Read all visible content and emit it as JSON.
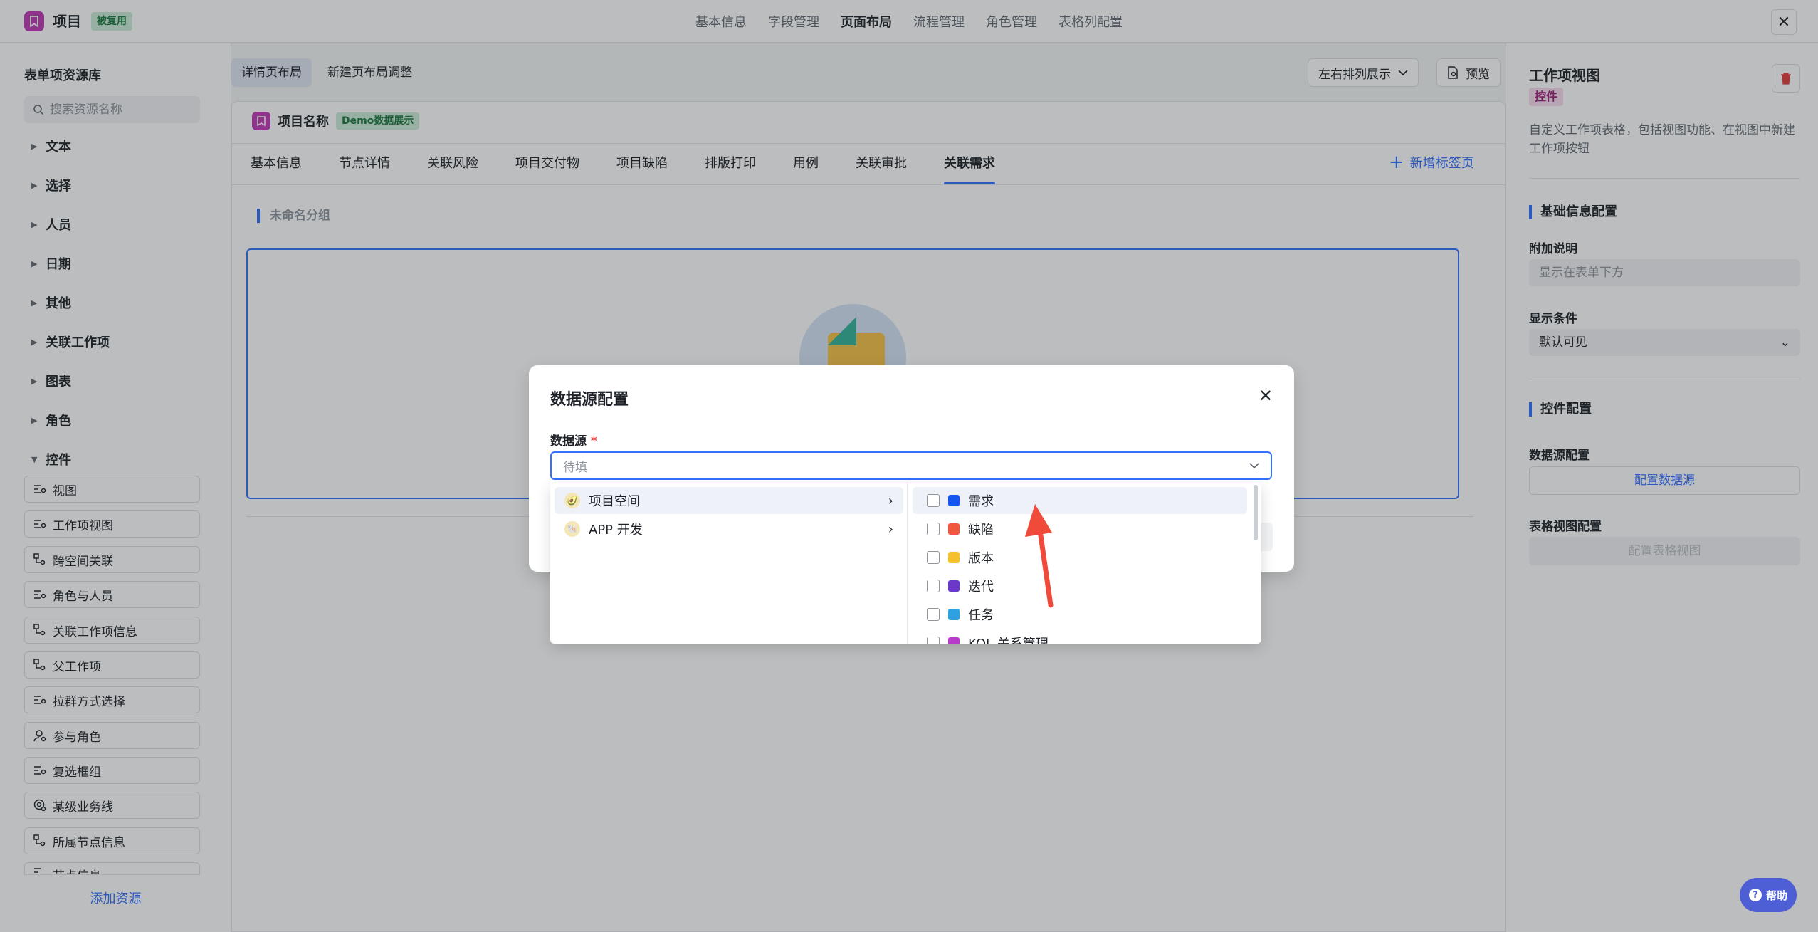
{
  "header": {
    "app_title": "项目",
    "app_badge": "被复用",
    "nav": [
      "基本信息",
      "字段管理",
      "页面布局",
      "流程管理",
      "角色管理",
      "表格列配置"
    ],
    "active_nav": "页面布局"
  },
  "sidebar": {
    "title": "表单项资源库",
    "search_placeholder": "搜索资源名称",
    "categories": [
      "文本",
      "选择",
      "人员",
      "日期",
      "其他",
      "关联工作项",
      "图表",
      "角色"
    ],
    "expanded_category": "控件",
    "widgets": [
      "视图",
      "工作项视图",
      "跨空间关联",
      "角色与人员",
      "关联工作项信息",
      "父工作项",
      "拉群方式选择",
      "参与角色",
      "复选框组",
      "某级业务线",
      "所属节点信息",
      "节点信息"
    ],
    "add_resource": "添加资源"
  },
  "center": {
    "segments": [
      "详情页布局",
      "新建页布局调整"
    ],
    "sort_button": "左右排列展示",
    "preview_button": "预览",
    "card_title": "项目名称",
    "card_badge": "Demo数据展示",
    "tabs": [
      "基本信息",
      "节点详情",
      "关联风险",
      "项目交付物",
      "项目缺陷",
      "排版打印",
      "用例",
      "关联审批",
      "关联需求"
    ],
    "active_tab": "关联需求",
    "add_tab": "新增标签页",
    "group_label": "未命名分组"
  },
  "right_panel": {
    "title": "工作项视图",
    "badge": "控件",
    "description": "自定义工作项表格，包括视图功能、在视图中新建工作项按钮",
    "basic_section": "基础信息配置",
    "extra_label": "附加说明",
    "extra_placeholder": "显示在表单下方",
    "display_label": "显示条件",
    "display_value": "默认可见",
    "control_section": "控件配置",
    "datasource_label": "数据源配置",
    "datasource_button": "配置数据源",
    "tableview_label": "表格视图配置",
    "tableview_button": "配置表格视图"
  },
  "help": {
    "label": "帮助"
  },
  "modal": {
    "title": "数据源配置",
    "field_label": "数据源",
    "required_mark": "*",
    "select_placeholder": "待填"
  },
  "dropdown": {
    "spaces": [
      {
        "label": "项目空间",
        "highlighted": true
      },
      {
        "label": "APP 开发",
        "highlighted": false
      }
    ],
    "types": [
      {
        "label": "需求",
        "color": "#1456f0",
        "highlighted": true
      },
      {
        "label": "缺陷",
        "color": "#f0573f",
        "highlighted": false
      },
      {
        "label": "版本",
        "color": "#f5c02d",
        "highlighted": false
      },
      {
        "label": "迭代",
        "color": "#6b38c9",
        "highlighted": false
      },
      {
        "label": "任务",
        "color": "#2ea1e0",
        "highlighted": false
      },
      {
        "label": "KOL 关系管理",
        "color": "#b63cc9",
        "highlighted": false
      }
    ]
  },
  "colors": {
    "accent": "#3370ff",
    "brand": "#c13cb6",
    "annotation_arrow": "#f04a3a"
  }
}
